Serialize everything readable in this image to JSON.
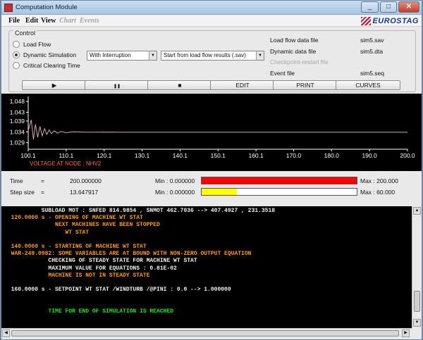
{
  "window": {
    "title": "Computation Module"
  },
  "menu": {
    "items": [
      {
        "label": "File",
        "disabled": false
      },
      {
        "label": "Edit",
        "disabled": false
      },
      {
        "label": "View",
        "disabled": false
      },
      {
        "label": "Chart",
        "disabled": true
      },
      {
        "label": "Events",
        "disabled": true
      }
    ]
  },
  "brand": {
    "name": "EUROSTAG"
  },
  "control": {
    "title": "Control",
    "modes": [
      {
        "label": "Load Flow",
        "selected": false
      },
      {
        "label": "Dynamic Simulation",
        "selected": true
      },
      {
        "label": "Critical Clearing Time",
        "selected": false
      }
    ],
    "interruption_select": "With Interruption",
    "start_select": "Start from load flow results (.sav)",
    "files": [
      {
        "label": "Load flow data file",
        "value": "sim5.sav",
        "disabled": false
      },
      {
        "label": "Dynamic data file",
        "value": "sim5.dta",
        "disabled": false
      },
      {
        "label": "Checkpoint-restart file",
        "value": "",
        "disabled": true
      },
      {
        "label": "Event file",
        "value": "sim5.seq",
        "disabled": false
      }
    ]
  },
  "buttons": {
    "play": "▶",
    "pause": "❚❚",
    "stop": "■",
    "edit": "EDIT",
    "print": "PRINT",
    "curves": "CURVES"
  },
  "chart_data": {
    "type": "line",
    "title": "",
    "caption": "VOLTAGE AT NODE : NHV2",
    "xlabel": "",
    "ylabel": "",
    "xlim": [
      100.1,
      200.0
    ],
    "ylim": [
      1.026,
      1.049
    ],
    "x_ticks": [
      "100.1",
      "110.1",
      "120.1",
      "130.1",
      "140.1",
      "150.1",
      "160.1",
      "170.0",
      "180.0",
      "190.0",
      "200.0"
    ],
    "y_ticks": [
      "1.048",
      "1.043",
      "1.039",
      "1.034",
      "1.029"
    ],
    "line_color": "#d8a8a8",
    "series": [
      {
        "x": [
          100.1,
          100.9,
          101.5,
          102.0,
          102.6,
          103.2,
          103.8,
          104.4,
          105.0,
          105.6,
          106.2,
          107.0,
          107.8,
          108.8,
          110.0,
          112.0,
          116.0,
          121.0,
          125.0,
          200.0
        ],
        "values": [
          1.0345,
          1.0395,
          1.0305,
          1.0375,
          1.0315,
          1.0365,
          1.0322,
          1.0355,
          1.0328,
          1.0349,
          1.0332,
          1.0345,
          1.0334,
          1.0342,
          1.0336,
          1.034,
          1.0338,
          1.0339,
          1.0338,
          1.0338
        ]
      }
    ]
  },
  "status": {
    "time_label": "Time",
    "time_eq": "=",
    "time_value": "200.000000",
    "step_label": "Step size",
    "step_eq": "=",
    "step_value": "13.647917",
    "time_min": "Min : 0.000000",
    "time_max": "Max : 200.000",
    "time_fraction": 1.0,
    "time_color": "#ff0000",
    "step_min": "Min : 0.000000",
    "step_max": "Max : 60.000",
    "step_fraction": 0.227,
    "step_color": "#ffff00"
  },
  "log": [
    {
      "text": "           SUBLOAD MOT : SNFED 814.9854 , SNMOT 462.7036 --> 407.4927 , 231.3518",
      "color": "white"
    },
    {
      "text": "  120.0000 s - OPENING OF MACHINE WT STAT",
      "color": "orange"
    },
    {
      "text": "               NEXT MACHINES HAVE BEEN STOPPED",
      "color": "orange"
    },
    {
      "text": "                  WT STAT",
      "color": "orange"
    },
    {
      "text": "",
      "color": "white"
    },
    {
      "text": "  140.0000 s - STARTING OF MACHINE WT STAT",
      "color": "orange"
    },
    {
      "text": "  WAR-249.0982: SOME VARIABLES ARE AT BOUND WITH NON-ZERO OUTPUT EQUATION",
      "color": "orange"
    },
    {
      "text": "             CHECKING OF STEADY STATE FOR MACHINE WT STAT",
      "color": "white"
    },
    {
      "text": "             MAXIMUM VALUE FOR EQUATIONS : 0.81E-02",
      "color": "white"
    },
    {
      "text": "             MACHINE IS NOT IN STEADY STATE",
      "color": "orange"
    },
    {
      "text": "",
      "color": "white"
    },
    {
      "text": "  160.0000 s - SETPOINT WT STAT /WINDTURB /@PINI : 0.0 --> 1.000000",
      "color": "white"
    },
    {
      "text": "",
      "color": "white"
    },
    {
      "text": "",
      "color": "white"
    },
    {
      "text": "             TIME FOR END OF SIMULATION IS REACHED",
      "color": "green"
    }
  ]
}
